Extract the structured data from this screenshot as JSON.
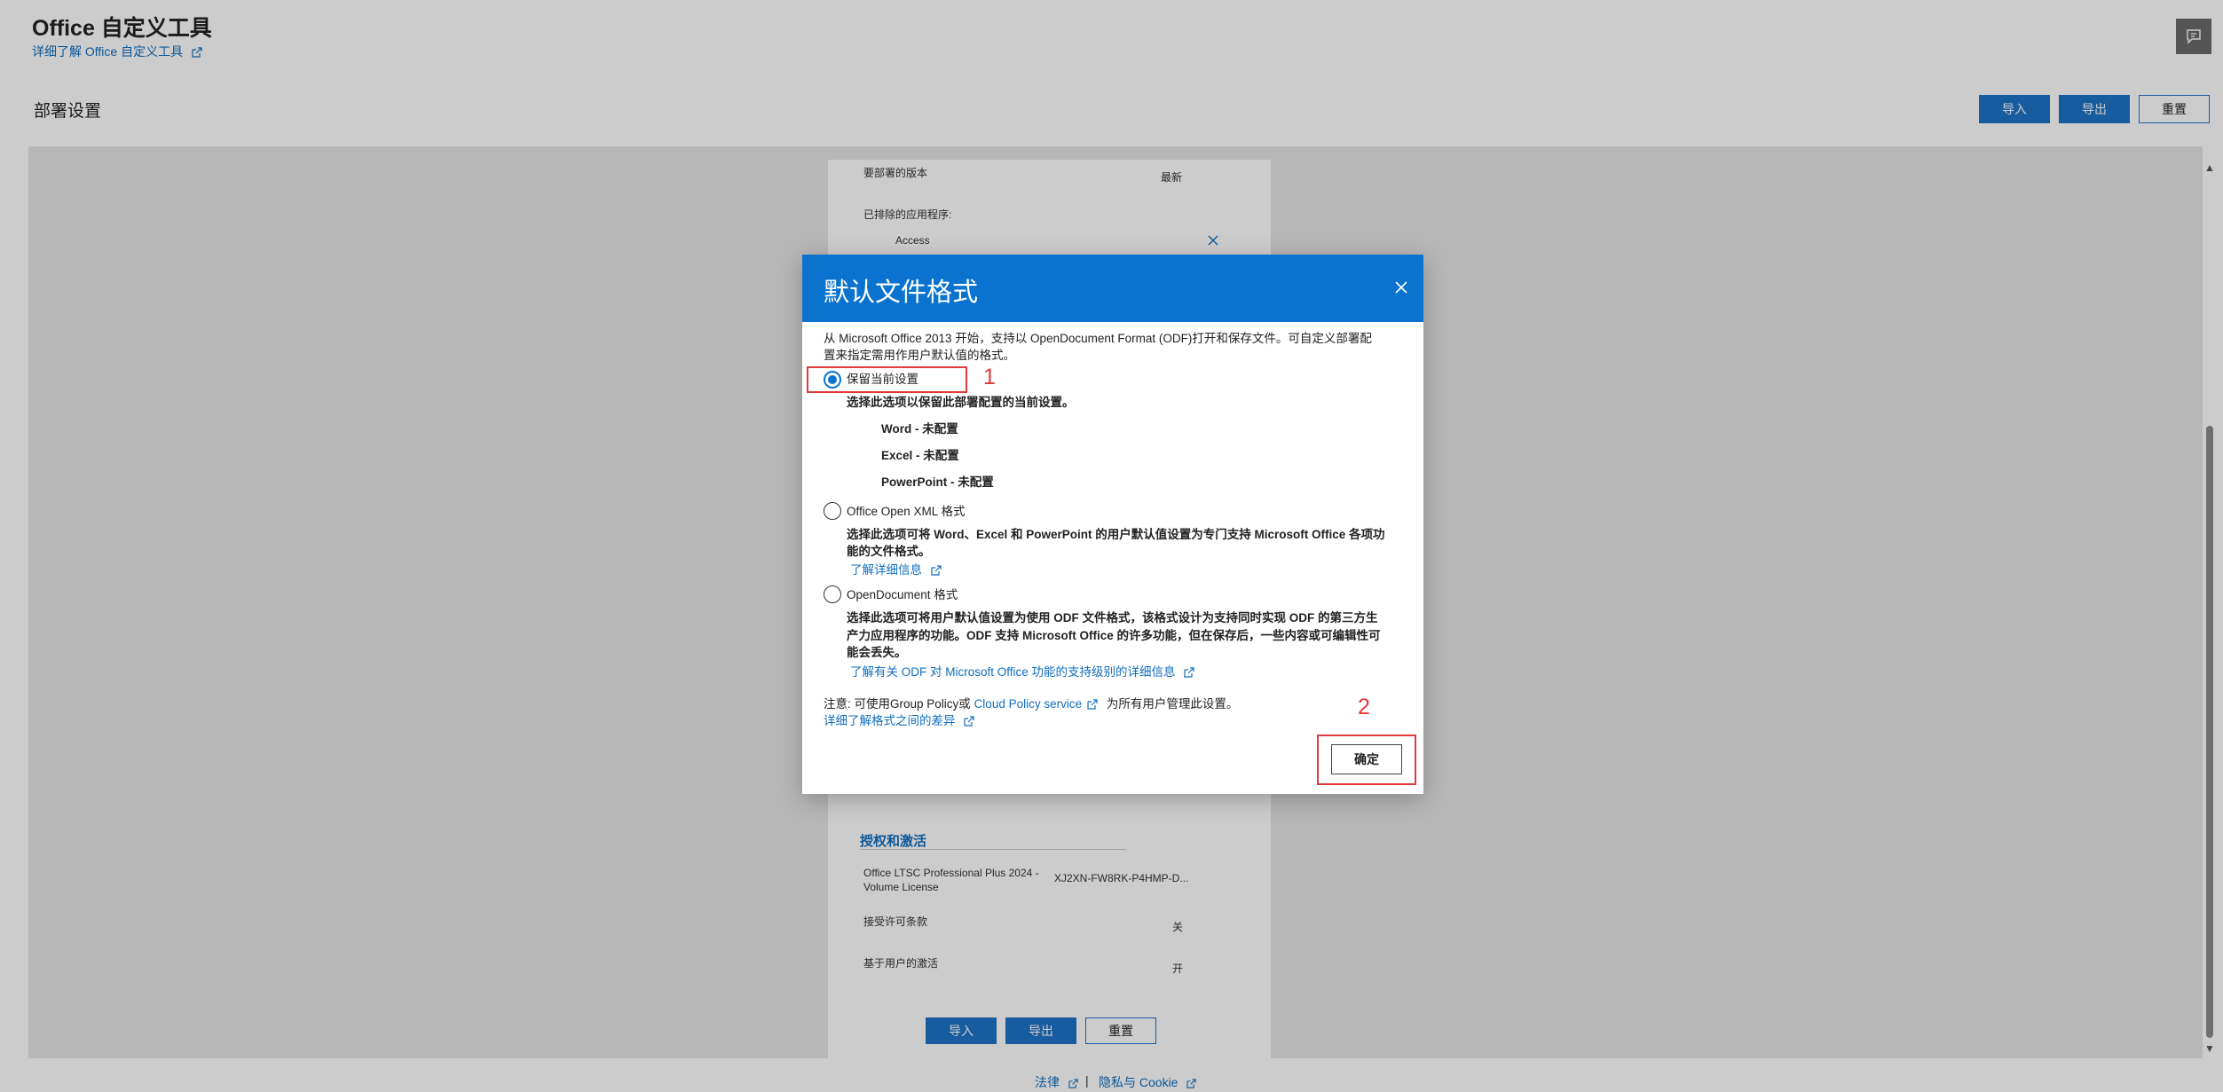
{
  "header": {
    "app_title": "Office 自定义工具",
    "learn_link": "详细了解 Office 自定义工具"
  },
  "section": {
    "title": "部署设置",
    "import_label": "导入",
    "export_label": "导出",
    "reset_label": "重置"
  },
  "summary": {
    "version_label": "要部署的版本",
    "version_value": "最新",
    "excluded_label": "已排除的应用程序:",
    "excluded_app": "Access",
    "licensing_title": "授权和激活",
    "product_line1": "Office LTSC Professional Plus 2024 -",
    "product_line2": "Volume License",
    "product_key": "XJ2XN-FW8RK-P4HMP-D...",
    "accept_eula_label": "接受许可条款",
    "accept_eula_value": "关",
    "user_activation_label": "基于用户的激活",
    "user_activation_value": "开",
    "import_label": "导入",
    "export_label": "导出",
    "reset_label": "重置"
  },
  "footer": {
    "legal": "法律",
    "separator": "|",
    "privacy": "隐私与 Cookie"
  },
  "dialog": {
    "title": "默认文件格式",
    "intro_line1": "从 Microsoft Office 2013 开始，支持以 OpenDocument Format (ODF)打开和保存文件。可自定义部署配",
    "intro_line2": "置来指定需用作用户默认值的格式。",
    "option1_label": "保留当前设置",
    "option1_desc": "选择此选项以保留此部署配置的当前设置。",
    "option1_items": [
      "Word - 未配置",
      "Excel - 未配置",
      "PowerPoint - 未配置"
    ],
    "option2_label": "Office Open XML 格式",
    "option2_desc_line1": "选择此选项可将 Word、Excel 和 PowerPoint 的用户默认值设置为专门支持 Microsoft Office 各项功",
    "option2_desc_line2": "能的文件格式。",
    "option2_link": "了解详细信息",
    "option3_label": "OpenDocument 格式",
    "option3_desc_line1": "选择此选项可将用户默认值设置为使用 ODF 文件格式，该格式设计为支持同时实现 ODF 的第三方生",
    "option3_desc_line2": "产力应用程序的功能。ODF 支持 Microsoft Office 的许多功能，但在保存后，一些内容或可编辑性可",
    "option3_desc_line3": "能会丢失。",
    "option3_link": "了解有关 ODF 对 Microsoft Office 功能的支持级别的详细信息",
    "note_prefix": "注意: 可使用Group Policy或",
    "note_link": "Cloud Policy service",
    "note_suffix": "为所有用户管理此设置。",
    "differences_link": "详细了解格式之间的差异",
    "ok_label": "确定",
    "selected_option": 1,
    "annotation_1": "1",
    "annotation_2": "2"
  },
  "colors": {
    "accent": "#0a73cf",
    "annotation": "#e23a3a"
  }
}
